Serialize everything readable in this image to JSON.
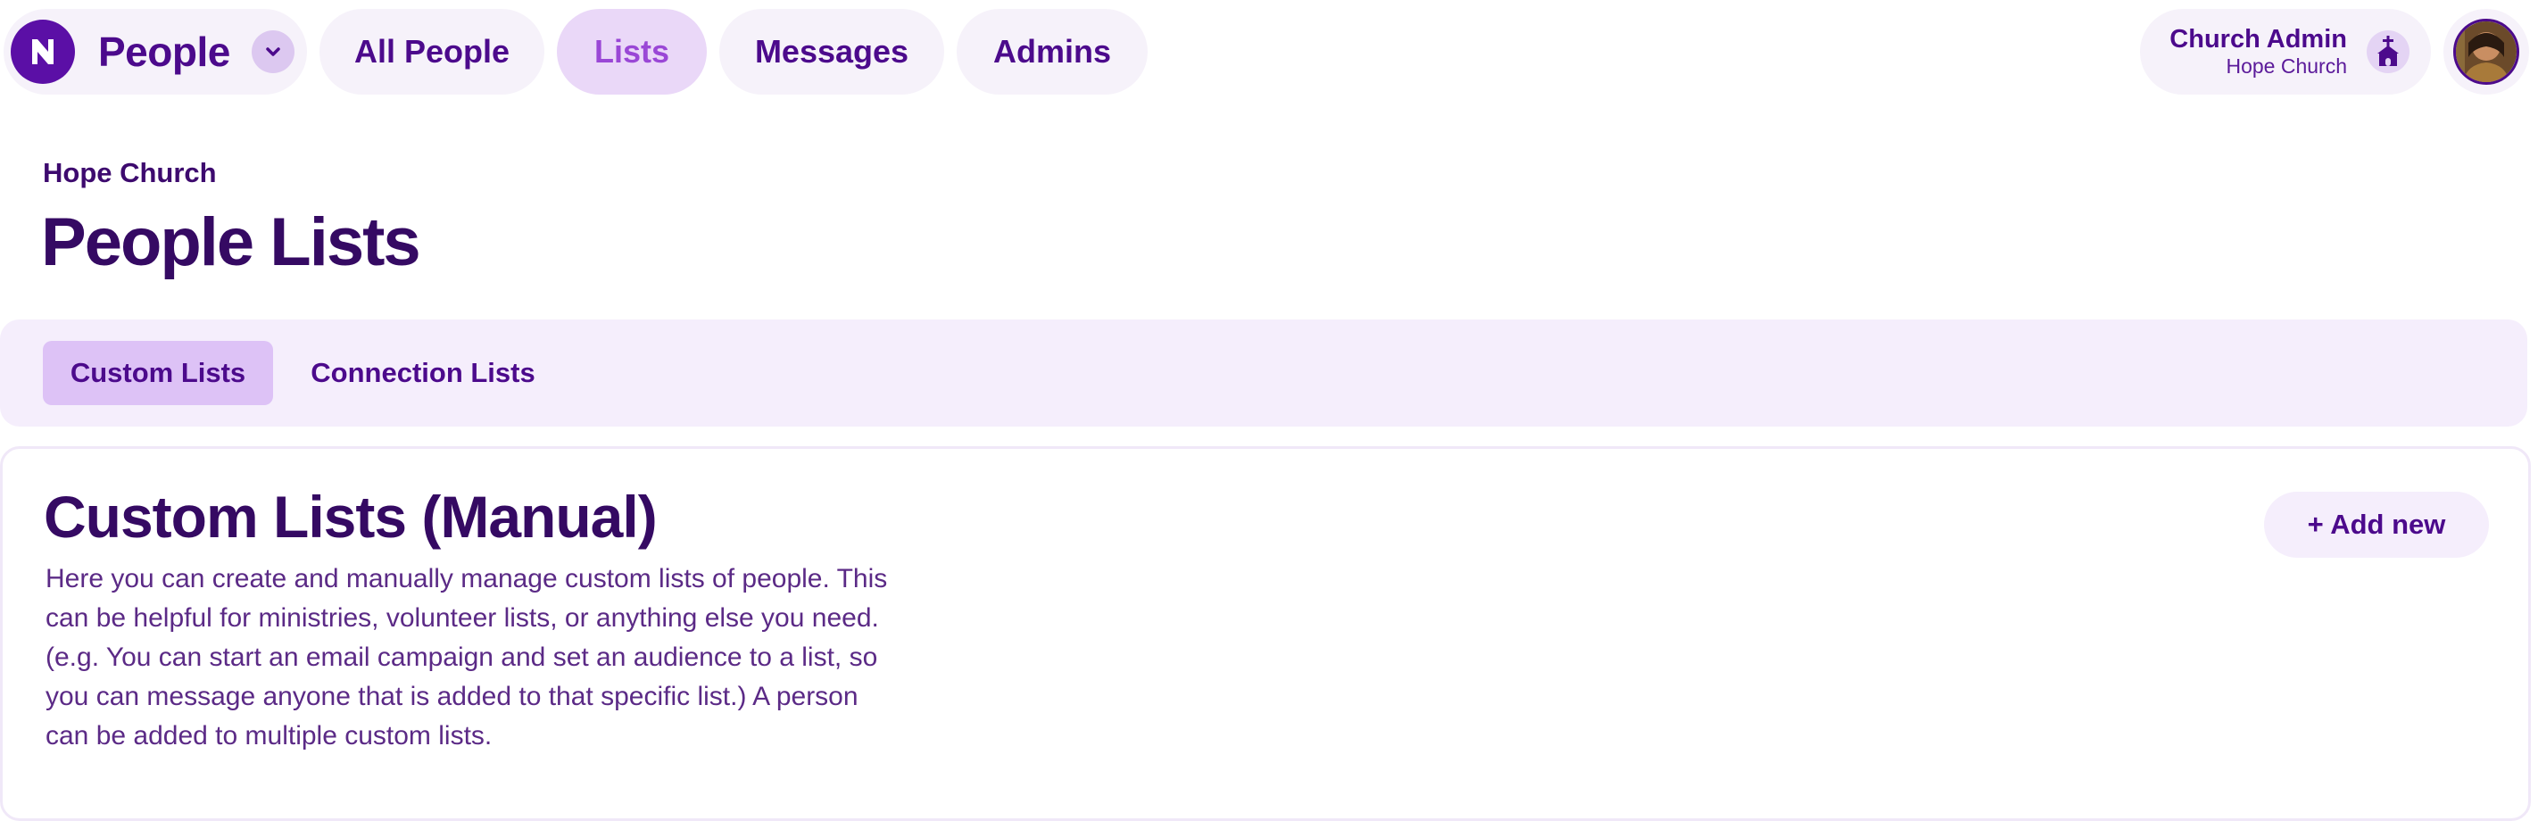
{
  "app": {
    "name": "People",
    "logo_icon": "app-logo-icon",
    "switcher_icon": "chevron-down-icon"
  },
  "nav": {
    "items": [
      {
        "label": "All People",
        "active": false
      },
      {
        "label": "Lists",
        "active": true
      },
      {
        "label": "Messages",
        "active": false
      },
      {
        "label": "Admins",
        "active": false
      }
    ]
  },
  "account": {
    "role": "Church Admin",
    "org": "Hope Church",
    "org_icon": "church-icon",
    "avatar_icon": "user-avatar"
  },
  "header": {
    "org_name": "Hope Church",
    "title": "People Lists"
  },
  "subtabs": [
    {
      "label": "Custom Lists",
      "active": true
    },
    {
      "label": "Connection Lists",
      "active": false
    }
  ],
  "card": {
    "title": "Custom Lists (Manual)",
    "description": "Here you can create and manually manage custom lists of people. This can be helpful for ministries, volunteer lists, or anything else you need. (e.g. You can start an email campaign and set an audience to a list, so you can message anyone that is added to that specific list.) A person can be added to multiple custom lists.",
    "add_label": "+ Add new"
  },
  "colors": {
    "brand": "#5b0fa6",
    "text_dark": "#350a63",
    "pill_bg": "#f6f2fa",
    "active_pill_bg": "#ead8f8",
    "active_pill_text": "#9a47d6",
    "subtab_bar_bg": "#f5eefc",
    "active_subtab_bg": "#ddc2f6"
  }
}
